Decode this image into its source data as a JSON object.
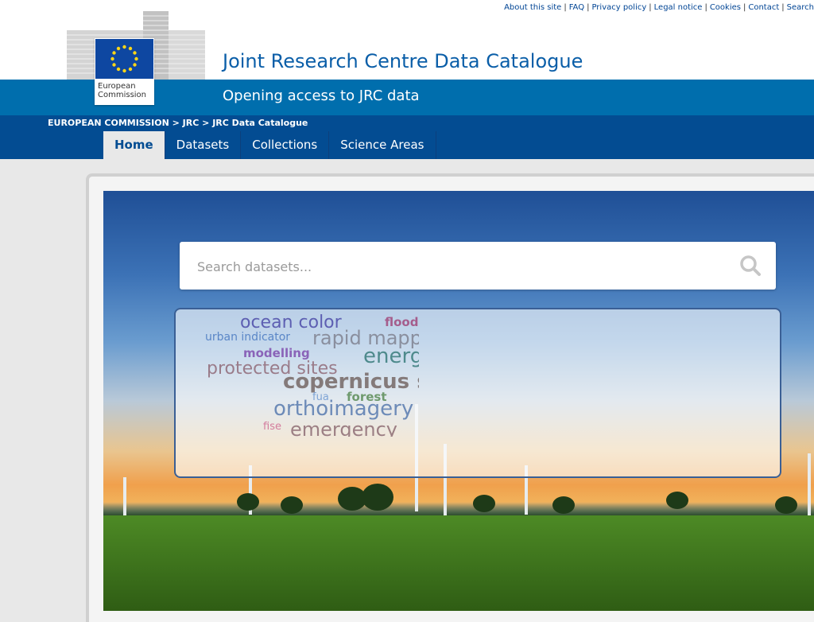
{
  "top_links": [
    "About this site",
    "FAQ",
    "Privacy policy",
    "Legal notice",
    "Cookies",
    "Contact",
    "Search"
  ],
  "logo": {
    "line1": "European",
    "line2": "Commission"
  },
  "site": {
    "title": "Joint Research Centre Data Catalogue",
    "tagline": "Opening access to JRC data"
  },
  "breadcrumb": "EUROPEAN COMMISSION > JRC > JRC Data Catalogue",
  "nav": {
    "tabs": [
      "Home",
      "Datasets",
      "Collections",
      "Science Areas"
    ],
    "active": "Home"
  },
  "search": {
    "placeholder": "Search datasets..."
  },
  "word_cloud": [
    {
      "text": "ocean color",
      "color": "#5d5fb2"
    },
    {
      "text": "flood",
      "color": "#a55d8c"
    },
    {
      "text": "urban indicator",
      "color": "#5a86c7"
    },
    {
      "text": "rapid mapping",
      "color": "#8a8f9e"
    },
    {
      "text": "modelling",
      "color": "#8a63b8"
    },
    {
      "text": "energy",
      "color": "#4e8a8c"
    },
    {
      "text": "protected sites",
      "color": "#9a7c8a"
    },
    {
      "text": "copernicus services",
      "color": "#847a7a"
    },
    {
      "text": "fua",
      "color": "#7fa4d6"
    },
    {
      "text": "forest",
      "color": "#6f9a6e"
    },
    {
      "text": "orthoimagery",
      "color": "#6d8bb8"
    },
    {
      "text": "fise",
      "color": "#d37c9d"
    },
    {
      "text": "emergency",
      "color": "#9c7f84"
    }
  ],
  "colors": {
    "header_blue": "#006ead",
    "nav_blue": "#034c92",
    "title_blue": "#0a5ea8"
  },
  "icons": {
    "search": "magnifier-icon",
    "logo": "eu-flag-icon"
  }
}
